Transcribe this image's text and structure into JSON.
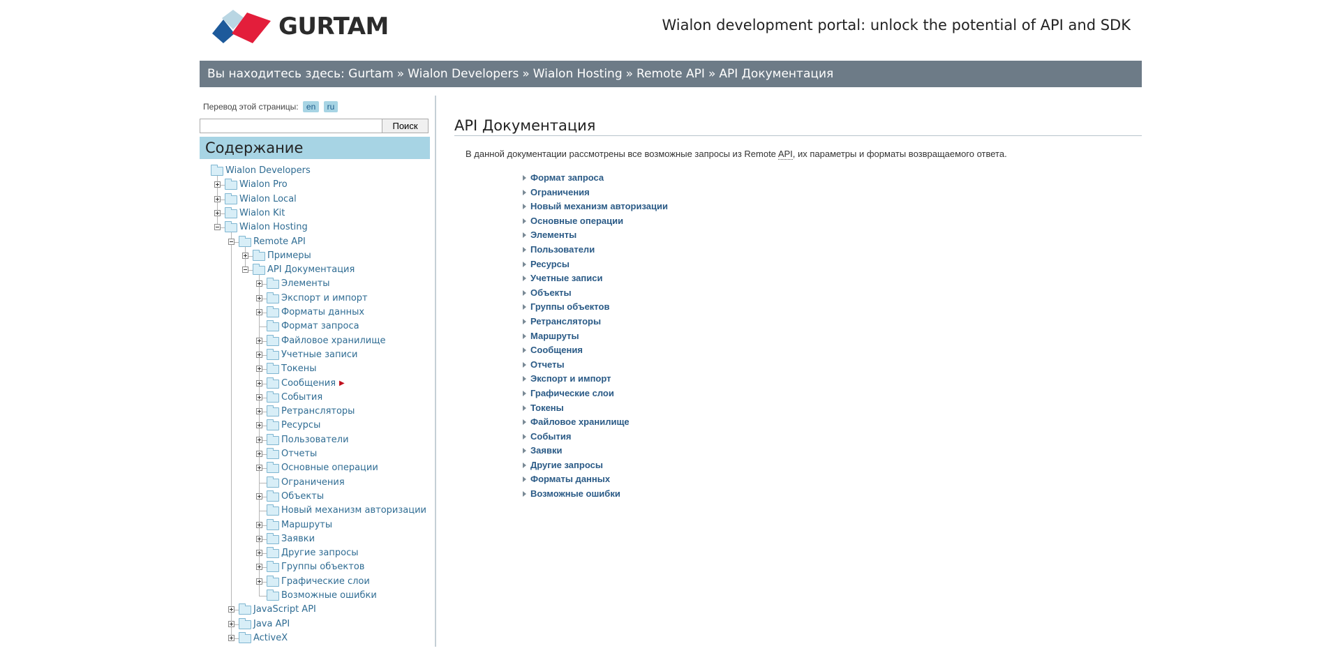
{
  "header": {
    "brand": "GURTAM",
    "tagline": "Wialon development portal: unlock the potential of API and SDK",
    "colors": {
      "logo_blue": "#1d5a9b",
      "logo_red": "#e31e3b",
      "logo_light": "#b9d6e3"
    }
  },
  "breadcrumb": {
    "prefix": "Вы находитесь здесь:",
    "items": [
      "Gurtam",
      "Wialon Developers",
      "Wialon Hosting",
      "Remote API",
      "API Документация"
    ],
    "separator": "»"
  },
  "language": {
    "label": "Перевод этой страницы:",
    "options": [
      "en",
      "ru"
    ]
  },
  "search": {
    "value": "",
    "button_label": "Поиск"
  },
  "toc": {
    "title": "Содержание",
    "nodes": [
      {
        "label": "Wialon Developers",
        "expander": "none"
      },
      {
        "label": "Wialon Pro",
        "expander": "plus"
      },
      {
        "label": "Wialon Local",
        "expander": "plus"
      },
      {
        "label": "Wialon Kit",
        "expander": "plus"
      },
      {
        "label": "Wialon Hosting",
        "expander": "minus"
      },
      {
        "label": "Remote API",
        "expander": "minus"
      },
      {
        "label": "Примеры",
        "expander": "plus"
      },
      {
        "label": "API Документация",
        "expander": "minus"
      },
      {
        "label": "Элементы",
        "expander": "plus"
      },
      {
        "label": "Экспорт и импорт",
        "expander": "plus"
      },
      {
        "label": "Форматы данных",
        "expander": "plus"
      },
      {
        "label": "Формат запроса",
        "expander": "none"
      },
      {
        "label": "Файловое хранилище",
        "expander": "plus"
      },
      {
        "label": "Учетные записи",
        "expander": "plus"
      },
      {
        "label": "Токены",
        "expander": "plus"
      },
      {
        "label": "Сообщения",
        "expander": "plus",
        "marker": "red-arrow-icon"
      },
      {
        "label": "События",
        "expander": "plus"
      },
      {
        "label": "Ретрансляторы",
        "expander": "plus"
      },
      {
        "label": "Ресурсы",
        "expander": "plus"
      },
      {
        "label": "Пользователи",
        "expander": "plus"
      },
      {
        "label": "Отчеты",
        "expander": "plus"
      },
      {
        "label": "Основные операции",
        "expander": "plus"
      },
      {
        "label": "Ограничения",
        "expander": "none"
      },
      {
        "label": "Объекты",
        "expander": "plus"
      },
      {
        "label": "Новый механизм авторизации",
        "expander": "none"
      },
      {
        "label": "Маршруты",
        "expander": "plus"
      },
      {
        "label": "Заявки",
        "expander": "plus"
      },
      {
        "label": "Другие запросы",
        "expander": "plus"
      },
      {
        "label": "Группы объектов",
        "expander": "plus"
      },
      {
        "label": "Графические слои",
        "expander": "plus"
      },
      {
        "label": "Возможные ошибки",
        "expander": "none"
      },
      {
        "label": "JavaScript API",
        "expander": "plus"
      },
      {
        "label": "Java API",
        "expander": "plus"
      },
      {
        "label": "ActiveX",
        "expander": "plus"
      }
    ]
  },
  "content": {
    "title": "API Документация",
    "intro_before": "В данной документации рассмотрены все возможные запросы из Remote ",
    "intro_abbr": "API",
    "intro_after": ", их параметры и форматы возвращаемого ответа.",
    "links": [
      "Формат запроса",
      "Ограничения",
      "Новый механизм авторизации",
      "Основные операции",
      "Элементы",
      "Пользователи",
      "Ресурсы",
      "Учетные записи",
      "Объекты",
      "Группы объектов",
      "Ретрансляторы",
      "Маршруты",
      "Сообщения",
      "Отчеты",
      "Экспорт и импорт",
      "Графические слои",
      "Токены",
      "Файловое хранилище",
      "События",
      "Заявки",
      "Другие запросы",
      "Форматы данных",
      "Возможные ошибки"
    ]
  }
}
